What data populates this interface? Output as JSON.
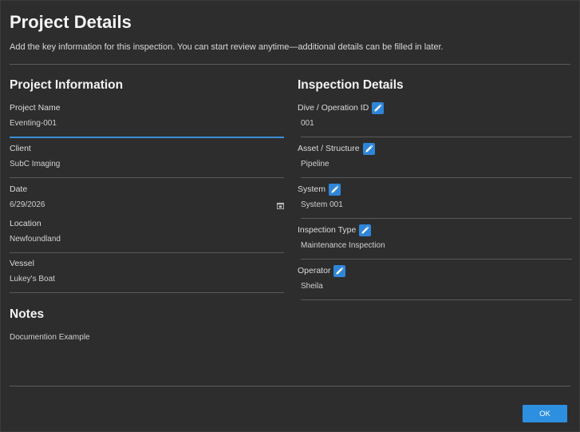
{
  "dialog": {
    "title": "Project Details",
    "subtitle": "Add the key information for this inspection. You can start review anytime—additional details can be filled in later."
  },
  "project_info": {
    "heading": "Project Information",
    "project_name": {
      "label": "Project Name",
      "value": "Eventing-001"
    },
    "client": {
      "label": "Client",
      "value": "SubC Imaging"
    },
    "date": {
      "label": "Date",
      "value": "6/29/2026"
    },
    "location": {
      "label": "Location",
      "value": "Newfoundland"
    },
    "vessel": {
      "label": "Vessel",
      "value": "Lukey's Boat"
    }
  },
  "inspection_details": {
    "heading": "Inspection Details",
    "dive_id": {
      "label": "Dive / Operation ID",
      "value": "001"
    },
    "asset": {
      "label": "Asset / Structure",
      "value": "Pipeline"
    },
    "system": {
      "label": "System",
      "value": "System 001"
    },
    "inspection_type": {
      "label": "Inspection Type",
      "value": "Maintenance Inspection"
    },
    "operator": {
      "label": "Operator",
      "value": "Sheila"
    }
  },
  "notes": {
    "heading": "Notes",
    "value": "Documention Example"
  },
  "footer": {
    "ok_label": "OK"
  },
  "colors": {
    "background": "#2d2d2d",
    "accent": "#2d8fe0",
    "active_underline": "#3b8fd6"
  },
  "icons": {
    "edit": "pencil-icon",
    "date": "calendar-icon"
  }
}
